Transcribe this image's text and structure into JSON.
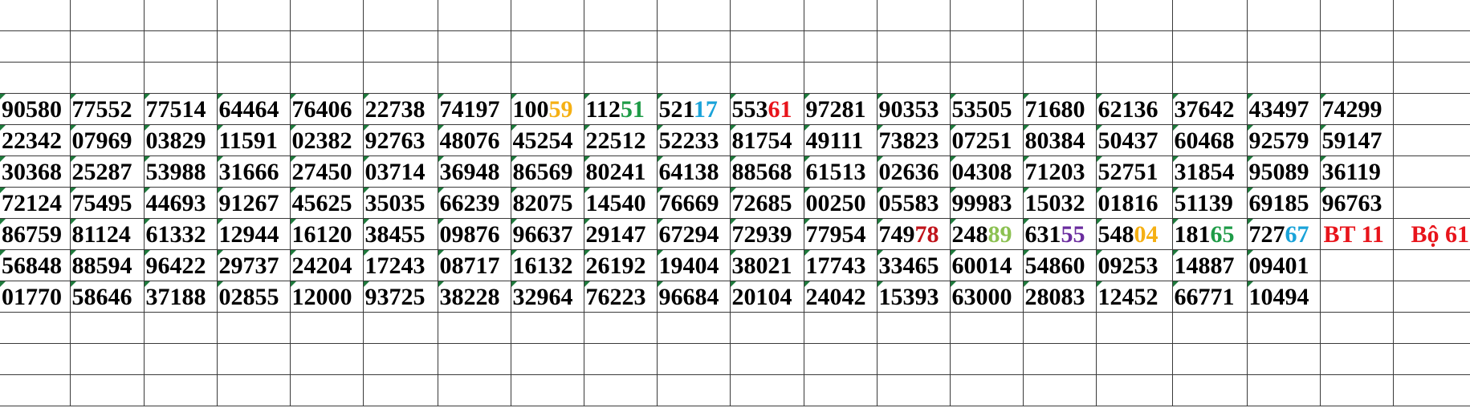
{
  "colors": {
    "text": "#000000",
    "grid": "#3a3a3a",
    "error_marker": "#1e7a3c",
    "note": "#e8141b"
  },
  "columns_count": 20,
  "rows": [
    {
      "cells": []
    },
    {
      "cells": []
    },
    {
      "cells": []
    },
    {
      "cells": [
        {
          "t": "90580"
        },
        {
          "t": "77552"
        },
        {
          "t": "77514"
        },
        {
          "t": "64464"
        },
        {
          "t": "76406"
        },
        {
          "t": "22738"
        },
        {
          "t": "74197"
        },
        {
          "t": "100",
          "hl": "59",
          "c": "#f5b014"
        },
        {
          "t": "112",
          "hl": "51",
          "c": "#1e9b47"
        },
        {
          "t": "521",
          "hl": "17",
          "c": "#1aa3d9"
        },
        {
          "t": "553",
          "hl": "61",
          "c": "#e8141b"
        },
        {
          "t": "97281"
        },
        {
          "t": "90353"
        },
        {
          "t": "53505"
        },
        {
          "t": "71680"
        },
        {
          "t": "62136"
        },
        {
          "t": "37642"
        },
        {
          "t": "43497"
        },
        {
          "t": "74299"
        }
      ]
    },
    {
      "cells": [
        {
          "t": "22342"
        },
        {
          "t": "07969"
        },
        {
          "t": "03829"
        },
        {
          "t": "11591"
        },
        {
          "t": "02382"
        },
        {
          "t": "92763"
        },
        {
          "t": "48076"
        },
        {
          "t": "45254"
        },
        {
          "t": "22512"
        },
        {
          "t": "52233"
        },
        {
          "t": "81754"
        },
        {
          "t": "49111"
        },
        {
          "t": "73823"
        },
        {
          "t": "07251"
        },
        {
          "t": "80384"
        },
        {
          "t": "50437"
        },
        {
          "t": "60468"
        },
        {
          "t": "92579"
        },
        {
          "t": "59147"
        }
      ]
    },
    {
      "cells": [
        {
          "t": "30368"
        },
        {
          "t": "25287"
        },
        {
          "t": "53988"
        },
        {
          "t": "31666"
        },
        {
          "t": "27450"
        },
        {
          "t": "03714"
        },
        {
          "t": "36948"
        },
        {
          "t": "86569"
        },
        {
          "t": "80241"
        },
        {
          "t": "64138"
        },
        {
          "t": "88568"
        },
        {
          "t": "61513"
        },
        {
          "t": "02636"
        },
        {
          "t": "04308"
        },
        {
          "t": "71203"
        },
        {
          "t": "52751"
        },
        {
          "t": "31854"
        },
        {
          "t": "95089"
        },
        {
          "t": "36119"
        }
      ]
    },
    {
      "cells": [
        {
          "t": "72124"
        },
        {
          "t": "75495"
        },
        {
          "t": "44693"
        },
        {
          "t": "91267"
        },
        {
          "t": "45625"
        },
        {
          "t": "35035"
        },
        {
          "t": "66239"
        },
        {
          "t": "82075"
        },
        {
          "t": "14540"
        },
        {
          "t": "76669"
        },
        {
          "t": "72685"
        },
        {
          "t": "00250"
        },
        {
          "t": "05583"
        },
        {
          "t": "99983"
        },
        {
          "t": "15032"
        },
        {
          "t": "01816"
        },
        {
          "t": "51139"
        },
        {
          "t": "69185"
        },
        {
          "t": "96763"
        }
      ]
    },
    {
      "cells": [
        {
          "t": "86759"
        },
        {
          "t": "81124"
        },
        {
          "t": "61332"
        },
        {
          "t": "12944"
        },
        {
          "t": "16120"
        },
        {
          "t": "38455"
        },
        {
          "t": "09876"
        },
        {
          "t": "96637"
        },
        {
          "t": "29147"
        },
        {
          "t": "67294"
        },
        {
          "t": "72939"
        },
        {
          "t": "77954"
        },
        {
          "t": "749",
          "hl": "78",
          "c": "#c0141b"
        },
        {
          "t": "248",
          "hl": "89",
          "c": "#8cc152"
        },
        {
          "t": "631",
          "hl": "55",
          "c": "#6a2c9e"
        },
        {
          "t": "548",
          "hl": "04",
          "c": "#f5b014"
        },
        {
          "t": "181",
          "hl": "65",
          "c": "#1e9b47"
        },
        {
          "t": "727",
          "hl": "67",
          "c": "#1aa3d9"
        },
        {
          "t": "BT 11",
          "note": true
        },
        {
          "t": "Bộ 61",
          "note": true
        }
      ]
    },
    {
      "cells": [
        {
          "t": "56848"
        },
        {
          "t": "88594"
        },
        {
          "t": "96422"
        },
        {
          "t": "29737"
        },
        {
          "t": "24204"
        },
        {
          "t": "17243"
        },
        {
          "t": "08717"
        },
        {
          "t": "16132"
        },
        {
          "t": "26192"
        },
        {
          "t": "19404"
        },
        {
          "t": "38021"
        },
        {
          "t": "17743"
        },
        {
          "t": "33465"
        },
        {
          "t": "60014"
        },
        {
          "t": "54860"
        },
        {
          "t": "09253"
        },
        {
          "t": "14887"
        },
        {
          "t": "09401"
        }
      ]
    },
    {
      "cells": [
        {
          "t": "01770"
        },
        {
          "t": "58646"
        },
        {
          "t": "37188"
        },
        {
          "t": "02855"
        },
        {
          "t": "12000"
        },
        {
          "t": "93725"
        },
        {
          "t": "38228"
        },
        {
          "t": "32964"
        },
        {
          "t": "76223"
        },
        {
          "t": "96684"
        },
        {
          "t": "20104"
        },
        {
          "t": "24042"
        },
        {
          "t": "15393"
        },
        {
          "t": "63000"
        },
        {
          "t": "28083"
        },
        {
          "t": "12452"
        },
        {
          "t": "66771"
        },
        {
          "t": "10494"
        }
      ]
    },
    {
      "cells": []
    },
    {
      "cells": []
    },
    {
      "cells": []
    }
  ]
}
